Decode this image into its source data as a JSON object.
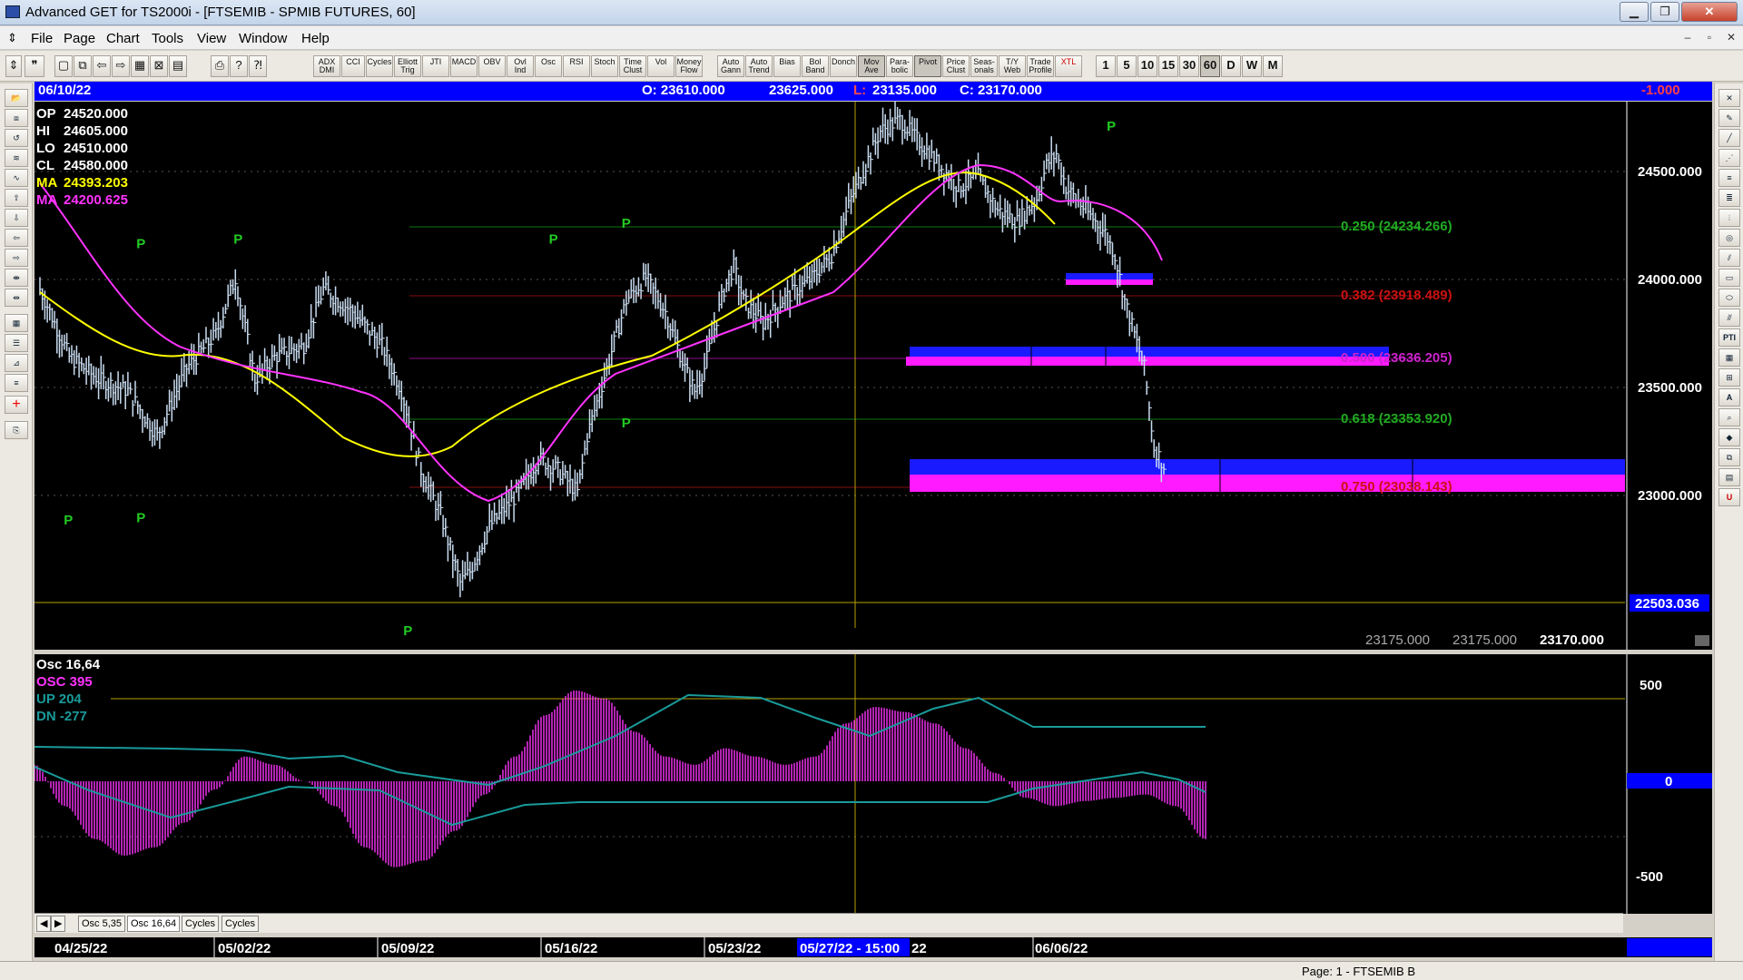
{
  "window": {
    "title": "Advanced GET for TS2000i - [FTSEMIB - SPMIB FUTURES, 60]",
    "min": "▁",
    "max": "❐",
    "close": "✕"
  },
  "menu": {
    "items": [
      "File",
      "Page",
      "Chart",
      "Tools",
      "View",
      "Window",
      "Help"
    ],
    "mdi": [
      "–",
      "▫",
      "✕"
    ]
  },
  "toolbar": {
    "studies": [
      "ADX DMI",
      "CCI",
      "Cycles",
      "Elliott Trig",
      "JTI",
      "MACD",
      "OBV",
      "Ovl Ind",
      "Osc",
      "RSI",
      "Stoch",
      "Time Clust",
      "Vol",
      "Money Flow",
      "Auto Gann",
      "Auto Trend",
      "Bias",
      "Bol Band",
      "Donch",
      "Mov Ave",
      "Para- bolic",
      "Pivot",
      "Price Clust",
      "Seas- onals",
      "T/Y Web",
      "Trade Profile",
      "XTL"
    ],
    "periods": [
      "1",
      "5",
      "10",
      "15",
      "30",
      "60",
      "D",
      "W",
      "M"
    ],
    "active_period": "60"
  },
  "quote_bar": {
    "date": "06/10/22",
    "open": "O: 23610.000",
    "high": "23625.000",
    "low_label": "L:",
    "low": "23135.000",
    "close": "C: 23170.000",
    "change": "-1.000"
  },
  "readout": [
    {
      "label": "OP",
      "value": "24520.000",
      "color": "#ffffff"
    },
    {
      "label": "HI",
      "value": "24605.000",
      "color": "#ffffff"
    },
    {
      "label": "LO",
      "value": "24510.000",
      "color": "#ffffff"
    },
    {
      "label": "CL",
      "value": "24580.000",
      "color": "#ffffff"
    },
    {
      "label": "MA",
      "value": "24393.203",
      "color": "#ffff00"
    },
    {
      "label": "MA",
      "value": "24200.625",
      "color": "#ff33ff"
    }
  ],
  "price_axis": {
    "ticks": [
      "24500.000",
      "24000.000",
      "23500.000",
      "23000.000"
    ],
    "cursor_price": "22503.036"
  },
  "bottom_values": [
    "23175.000",
    "23175.000",
    "23170.000"
  ],
  "fib_levels": [
    {
      "label": "0.250 (24234.266)",
      "color": "#22aa22"
    },
    {
      "label": "0.382 (23918.489)",
      "color": "#cc1111"
    },
    {
      "label": "0.500 (23636.205)",
      "color": "#cc22cc"
    },
    {
      "label": "0.618 (23353.920)",
      "color": "#22aa22"
    },
    {
      "label": "0.750 (23038.143)",
      "color": "#cc1111"
    }
  ],
  "pivot_marker": "P",
  "oscillator": {
    "legend": [
      {
        "label": "Osc 16,64",
        "color": "#ffffff"
      },
      {
        "label": "OSC 395",
        "color": "#ff33ff"
      },
      {
        "label": "UP  204",
        "color": "#1a9a9a"
      },
      {
        "label": "DN  -277",
        "color": "#1a9a9a"
      }
    ],
    "ticks": [
      "500",
      "0",
      "-500"
    ]
  },
  "tabs": [
    "Osc 5,35",
    "Osc 16,64",
    "Cycles",
    "Cycles"
  ],
  "active_tab": "Osc 16,64",
  "dates": [
    "04/25/22",
    "05/02/22",
    "05/09/22",
    "05/16/22",
    "05/23/22",
    "05/27/22 - 15:00",
    "22",
    "06/06/22"
  ],
  "status": "Page: 1 - FTSEMIB B",
  "colors": {
    "ma_fast": "#ffff00",
    "ma_slow": "#ff33ff",
    "bars": "#c8dcf0",
    "zone_blue": "#1a1aff",
    "zone_magenta": "#ff1aff",
    "osc_hist": "#ff33ff",
    "osc_band": "#1a9a9a"
  },
  "chart_data": {
    "type": "bar",
    "title": "FTSEMIB - SPMIB FUTURES, 60",
    "x_range": [
      "04/25/22",
      "06/10/22"
    ],
    "ylim": [
      22450,
      24780
    ],
    "close_path": [
      [
        0,
        23950
      ],
      [
        3,
        23650
      ],
      [
        6,
        23550
      ],
      [
        9,
        23500
      ],
      [
        12,
        23300
      ],
      [
        15,
        23600
      ],
      [
        18,
        23750
      ],
      [
        20,
        24000
      ],
      [
        22,
        23550
      ],
      [
        24,
        23650
      ],
      [
        27,
        23700
      ],
      [
        29,
        23950
      ],
      [
        32,
        23850
      ],
      [
        35,
        23700
      ],
      [
        37,
        23500
      ],
      [
        39,
        23150
      ],
      [
        41,
        22950
      ],
      [
        43,
        22650
      ],
      [
        44,
        22700
      ],
      [
        46,
        22900
      ],
      [
        49,
        23050
      ],
      [
        51,
        23200
      ],
      [
        53,
        23150
      ],
      [
        55,
        23050
      ],
      [
        56,
        23300
      ],
      [
        58,
        23600
      ],
      [
        60,
        23900
      ],
      [
        62,
        24000
      ],
      [
        64,
        23850
      ],
      [
        66,
        23600
      ],
      [
        67,
        23500
      ],
      [
        68,
        23600
      ],
      [
        70,
        23950
      ],
      [
        71,
        24050
      ],
      [
        72,
        23900
      ],
      [
        74,
        23800
      ],
      [
        76,
        23900
      ],
      [
        79,
        24000
      ],
      [
        81,
        24100
      ],
      [
        83,
        24350
      ],
      [
        85,
        24550
      ],
      [
        86,
        24650
      ],
      [
        88,
        24700
      ],
      [
        90,
        24600
      ],
      [
        92,
        24500
      ],
      [
        94,
        24400
      ],
      [
        96,
        24450
      ],
      [
        98,
        24300
      ],
      [
        100,
        24250
      ],
      [
        102,
        24350
      ],
      [
        103,
        24500
      ],
      [
        104,
        24550
      ],
      [
        105,
        24400
      ],
      [
        107,
        24300
      ],
      [
        109,
        24200
      ],
      [
        110,
        24100
      ],
      [
        111,
        23900
      ],
      [
        113,
        23600
      ],
      [
        114,
        23250
      ],
      [
        115,
        23170
      ]
    ],
    "pivots": [
      {
        "x": "04/26/22",
        "y": 22980,
        "type": "low"
      },
      {
        "x": "04/29/22",
        "y": 24100,
        "type": "high"
      },
      {
        "x": "04/29/22",
        "y": 22990,
        "type": "low"
      },
      {
        "x": "05/03/22",
        "y": 24120,
        "type": "high"
      },
      {
        "x": "05/10/22",
        "y": 22490,
        "type": "low"
      },
      {
        "x": "05/16/22",
        "y": 24120,
        "type": "high"
      },
      {
        "x": "05/19/22",
        "y": 23410,
        "type": "low"
      },
      {
        "x": "05/19/22",
        "y": 24190,
        "type": "high"
      },
      {
        "x": "06/08/22",
        "y": 24620,
        "type": "high"
      }
    ],
    "osc_values": [
      100,
      -150,
      -350,
      -450,
      -400,
      -250,
      -50,
      150,
      100,
      0,
      -150,
      -400,
      -520,
      -480,
      -300,
      -80,
      150,
      400,
      550,
      500,
      300,
      150,
      100,
      200,
      150,
      100,
      150,
      350,
      450,
      420,
      350,
      200,
      50,
      -100,
      -150,
      -120,
      -100,
      -80,
      -150,
      -350
    ]
  }
}
